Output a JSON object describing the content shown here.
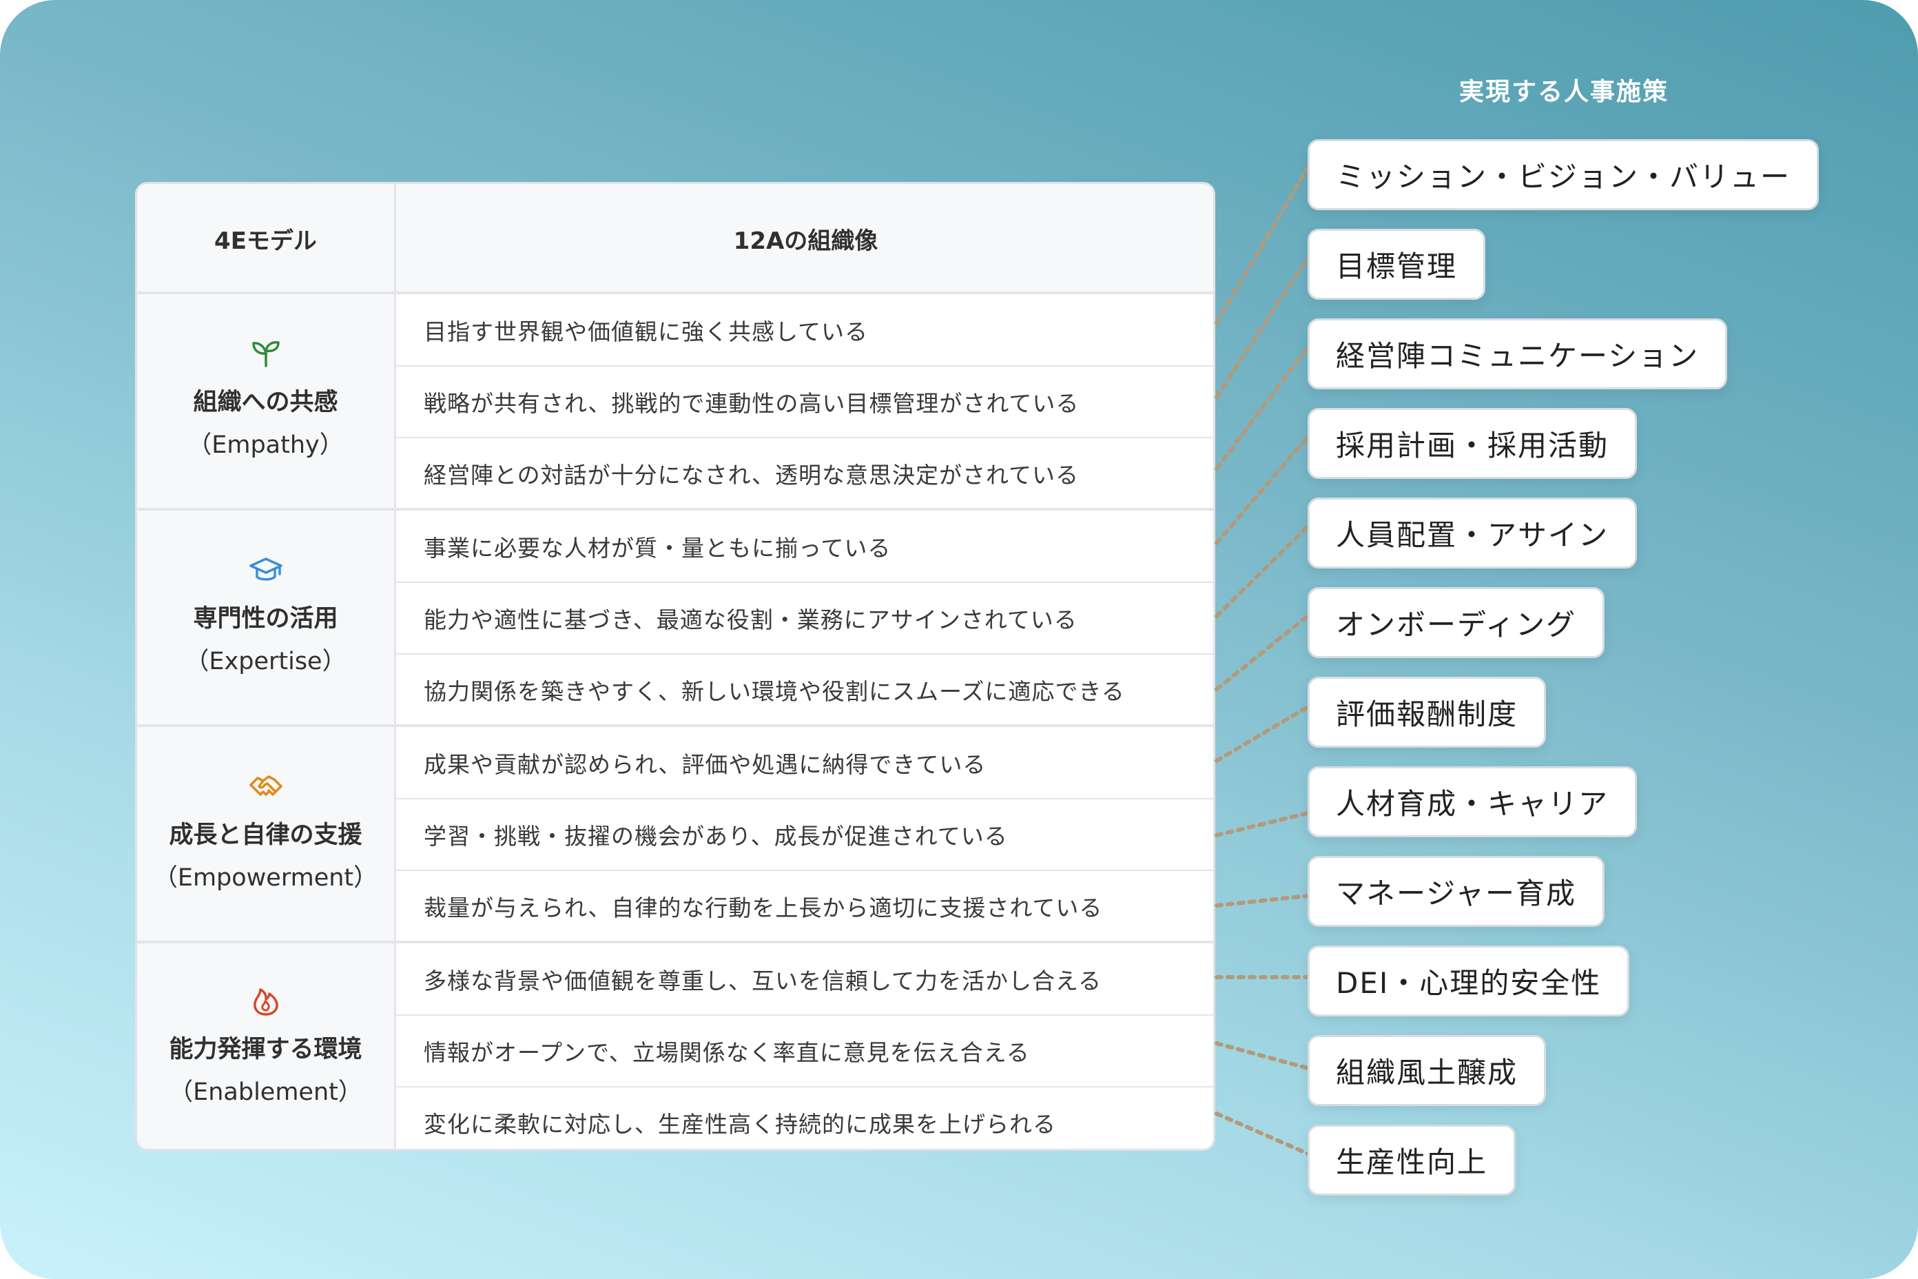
{
  "table": {
    "header_model": "4Eモデル",
    "header_org": "12Aの組織像",
    "categories": [
      {
        "title": "組織への共感",
        "subtitle": "（Empathy）",
        "icon": "sprout-icon",
        "color": "#2e8b3a"
      },
      {
        "title": "専門性の活用",
        "subtitle": "（Expertise）",
        "icon": "graduation-cap-icon",
        "color": "#3a8fd8"
      },
      {
        "title": "成長と自律の支援",
        "subtitle": "（Empowerment）",
        "icon": "handshake-icon",
        "color": "#e08a1e"
      },
      {
        "title": "能力発揮する環境",
        "subtitle": "（Enablement）",
        "icon": "flame-icon",
        "color": "#d9452b"
      }
    ],
    "rows": [
      "目指す世界観や価値観に強く共感している",
      "戦略が共有され、挑戦的で連動性の高い目標管理がされている",
      "経営陣との対話が十分になされ、透明な意思決定がされている",
      "事業に必要な人材が質・量ともに揃っている",
      "能力や適性に基づき、最適な役割・業務にアサインされている",
      "協力関係を築きやすく、新しい環境や役割にスムーズに適応できる",
      "成果や貢献が認められ、評価や処遇に納得できている",
      "学習・挑戦・抜擢の機会があり、成長が促進されている",
      "裁量が与えられ、自律的な行動を上長から適切に支援されている",
      "多様な背景や価値観を尊重し、互いを信頼して力を活かし合える",
      "情報がオープンで、立場関係なく率直に意見を伝え合える",
      "変化に柔軟に対応し、生産性高く持続的に成果を上げられる"
    ]
  },
  "measures": {
    "title": "実現する人事施策",
    "items": [
      "ミッション・ビジョン・バリュー",
      "目標管理",
      "経営陣コミュニケーション",
      "採用計画・採用活動",
      "人員配置・アサイン",
      "オンボーディング",
      "評価報酬制度",
      "人材育成・キャリア",
      "マネージャー育成",
      "DEI・心理的安全性",
      "組織風土醸成",
      "生産性向上"
    ]
  },
  "colors": {
    "connector": "#b39a7c"
  }
}
